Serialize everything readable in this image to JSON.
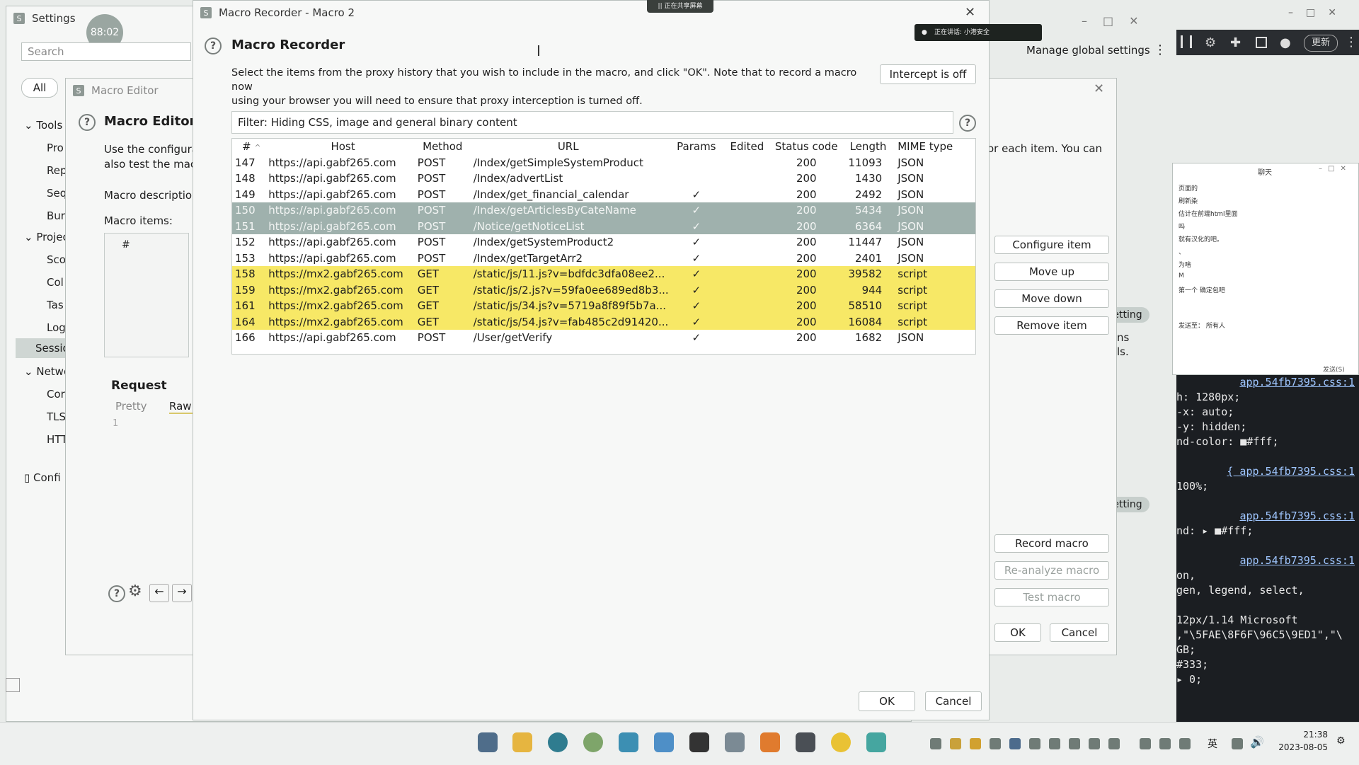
{
  "settings": {
    "title": "Settings",
    "timer": "88:02",
    "search_placeholder": "Search",
    "all_label": "All",
    "tree": [
      "Tools",
      "Pro",
      "Rep",
      "Seq",
      "Bur",
      "Projec",
      "Sco",
      "Col",
      "Tas",
      "Log",
      "Sessio",
      "Netwo",
      "Cor",
      "TLS",
      "HTT",
      "Confi"
    ],
    "manage_global": "Manage global settings",
    "setting_chip": "etting",
    "right_fragment_1": "ns",
    "right_fragment_2": "ls."
  },
  "macro_editor": {
    "window_title": "Macro Editor",
    "heading": "Macro Editor",
    "desc_line1": "Use the configura",
    "desc_line2": "also test the macr",
    "macro_description_label": "Macro description",
    "macro_items_label": "Macro items:",
    "items_col_hash": "#",
    "request_label": "Request",
    "tab_pretty": "Pretty",
    "tab_raw": "Raw",
    "line_no": "1",
    "right_text": "or each item. You can",
    "buttons": {
      "configure": "Configure item",
      "move_up": "Move up",
      "move_down": "Move down",
      "remove": "Remove item",
      "record": "Record macro",
      "reanalyze": "Re-analyze macro",
      "test": "Test macro",
      "ok": "OK",
      "cancel": "Cancel"
    }
  },
  "recorder": {
    "window_title": "Macro Recorder - Macro 2",
    "heading": "Macro Recorder",
    "instructions_line1": "Select the items from the proxy history that you wish to include in the macro, and click \"OK\". Note that to record a macro now",
    "instructions_line2": "using your browser you will need to ensure that proxy interception is turned off.",
    "intercept_button": "Intercept is off",
    "filter_text": "Filter: Hiding CSS, image and general binary content",
    "columns": [
      "#",
      "Host",
      "Method",
      "URL",
      "Params",
      "Edited",
      "Status code",
      "Length",
      "MIME type"
    ],
    "rows": [
      {
        "id": "147",
        "host": "https://api.gabf265.com",
        "method": "POST",
        "url": "/Index/getSimpleSystemProduct",
        "params": "",
        "edited": "",
        "status": "200",
        "length": "11093",
        "mime": "JSON",
        "hl": "none"
      },
      {
        "id": "148",
        "host": "https://api.gabf265.com",
        "method": "POST",
        "url": "/Index/advertList",
        "params": "",
        "edited": "",
        "status": "200",
        "length": "1430",
        "mime": "JSON",
        "hl": "none"
      },
      {
        "id": "149",
        "host": "https://api.gabf265.com",
        "method": "POST",
        "url": "/Index/get_financial_calendar",
        "params": "✓",
        "edited": "",
        "status": "200",
        "length": "2492",
        "mime": "JSON",
        "hl": "none"
      },
      {
        "id": "150",
        "host": "https://api.gabf265.com",
        "method": "POST",
        "url": "/Index/getArticlesByCateName",
        "params": "✓",
        "edited": "",
        "status": "200",
        "length": "5434",
        "mime": "JSON",
        "hl": "selected"
      },
      {
        "id": "151",
        "host": "https://api.gabf265.com",
        "method": "POST",
        "url": "/Notice/getNoticeList",
        "params": "✓",
        "edited": "",
        "status": "200",
        "length": "6364",
        "mime": "JSON",
        "hl": "selected"
      },
      {
        "id": "152",
        "host": "https://api.gabf265.com",
        "method": "POST",
        "url": "/Index/getSystemProduct2",
        "params": "✓",
        "edited": "",
        "status": "200",
        "length": "11447",
        "mime": "JSON",
        "hl": "none"
      },
      {
        "id": "153",
        "host": "https://api.gabf265.com",
        "method": "POST",
        "url": "/Index/getTargetArr2",
        "params": "✓",
        "edited": "",
        "status": "200",
        "length": "2401",
        "mime": "JSON",
        "hl": "none"
      },
      {
        "id": "158",
        "host": "https://mx2.gabf265.com",
        "method": "GET",
        "url": "/static/js/11.js?v=bdfdc3dfa08ee2...",
        "params": "✓",
        "edited": "",
        "status": "200",
        "length": "39582",
        "mime": "script",
        "hl": "yellow"
      },
      {
        "id": "159",
        "host": "https://mx2.gabf265.com",
        "method": "GET",
        "url": "/static/js/2.js?v=59fa0ee689ed8b3...",
        "params": "✓",
        "edited": "",
        "status": "200",
        "length": "944",
        "mime": "script",
        "hl": "yellow"
      },
      {
        "id": "161",
        "host": "https://mx2.gabf265.com",
        "method": "GET",
        "url": "/static/js/34.js?v=5719a8f89f5b7a...",
        "params": "✓",
        "edited": "",
        "status": "200",
        "length": "58510",
        "mime": "script",
        "hl": "yellow"
      },
      {
        "id": "164",
        "host": "https://mx2.gabf265.com",
        "method": "GET",
        "url": "/static/js/54.js?v=fab485c2d91420...",
        "params": "✓",
        "edited": "",
        "status": "200",
        "length": "16084",
        "mime": "script",
        "hl": "yellow"
      },
      {
        "id": "166",
        "host": "https://api.gabf265.com",
        "method": "POST",
        "url": "/User/getVerify",
        "params": "✓",
        "edited": "",
        "status": "200",
        "length": "1682",
        "mime": "JSON",
        "hl": "none"
      }
    ],
    "ok": "OK",
    "cancel": "Cancel",
    "sort_indicator": "^"
  },
  "chat_panel": {
    "title": "聊天",
    "lines": [
      "页面的",
      "刷新染",
      "估计在前端html里面",
      "吗",
      "就有汉化的吧。",
      "、",
      "为啥",
      "M",
      "第一个 确定包吧"
    ],
    "send_to_label": "发送至：",
    "send_to_value": "所有人",
    "send_button": "发送(S)"
  },
  "devtools": {
    "lines": [
      {
        "text": "app.54fb7395.css:1",
        "link": true
      },
      {
        "text": "h: 1280px;",
        "link": false
      },
      {
        "text": "-x: auto;",
        "link": false
      },
      {
        "text": "-y: hidden;",
        "link": false
      },
      {
        "text": "nd-color: ■#fff;",
        "link": false
      },
      {
        "text": "",
        "link": false
      },
      {
        "text": "{        app.54fb7395.css:1",
        "link": true
      },
      {
        "text": "100%;",
        "link": false
      },
      {
        "text": "",
        "link": false
      },
      {
        "text": "app.54fb7395.css:1",
        "link": true
      },
      {
        "text": "nd: ▸ ■#fff;",
        "link": false
      },
      {
        "text": "",
        "link": false
      },
      {
        "text": "app.54fb7395.css:1",
        "link": true
      },
      {
        "text": "on,",
        "link": false
      },
      {
        "text": "gen, legend, select,",
        "link": false
      },
      {
        "text": "",
        "link": false
      },
      {
        "text": "12px/1.14 Microsoft",
        "link": false
      },
      {
        "text": ",\"\\5FAE\\8F6F\\96C5\\9ED1\",\"\\",
        "link": false
      },
      {
        "text": "GB;",
        "link": false
      },
      {
        "text": " #333;",
        "link": false
      },
      {
        "text": " ▸ 0;",
        "link": false
      }
    ]
  },
  "browser_toolbar": {
    "update_label": "更新"
  },
  "overlay": {
    "recording_badge": "|| 正在共享屏幕",
    "meeting_text": "正在讲话: 小港安全"
  },
  "taskbar": {
    "time": "21:38",
    "date": "2023-08-05",
    "ime": "英"
  }
}
